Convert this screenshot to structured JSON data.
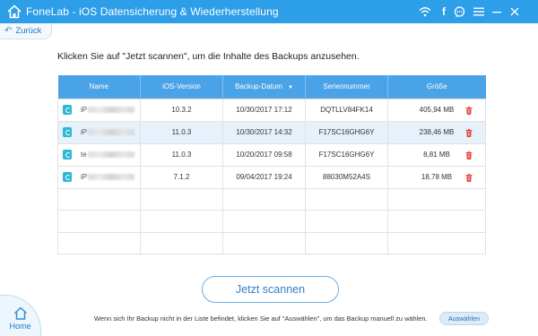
{
  "window": {
    "title": "FoneLab - iOS Datensicherung & Wiederherstellung",
    "colors": {
      "titlebar": "#2d9ee8",
      "accent": "#2177c4",
      "header": "#4aa3e6",
      "delete": "#e4443a"
    }
  },
  "toolbar": {
    "icons": [
      "wifi-icon",
      "facebook-icon",
      "chat-icon",
      "menu-icon",
      "minimize-icon",
      "close-icon"
    ],
    "facebook_glyph": "f"
  },
  "nav": {
    "back_label": "Zurück",
    "home_label": "Home"
  },
  "main": {
    "instruction": "Klicken Sie auf \"Jetzt scannen\", um die Inhalte des Backups anzusehen.",
    "table": {
      "columns": [
        "Name",
        "iOS-Version",
        "Backup-Datum",
        "Seriennummer",
        "Größe"
      ],
      "sort_indicator": "▼",
      "rows": [
        {
          "name_prefix": "iP",
          "ios": "10.3.2",
          "date": "10/30/2017 17:12",
          "serial": "DQTLLV84FK14",
          "size": "405,94 MB",
          "selected": false
        },
        {
          "name_prefix": "iP",
          "ios": "11.0.3",
          "date": "10/30/2017 14:32",
          "serial": "F17SC16GHG6Y",
          "size": "238,46 MB",
          "selected": true
        },
        {
          "name_prefix": "te",
          "ios": "11.0.3",
          "date": "10/20/2017 09:58",
          "serial": "F17SC16GHG6Y",
          "size": "8,81 MB",
          "selected": false
        },
        {
          "name_prefix": "iP",
          "ios": "7.1.2",
          "date": "09/04/2017 19:24",
          "serial": "88030M52A4S",
          "size": "18,78 MB",
          "selected": false
        }
      ]
    },
    "scan_button": "Jetzt scannen"
  },
  "footer": {
    "note": "Wenn sich Ihr Backup nicht in der Liste befindet, klicken Sie auf \"Auswählen\", um das Backup manuell zu wählen.",
    "choose_button": "Auswählen"
  }
}
